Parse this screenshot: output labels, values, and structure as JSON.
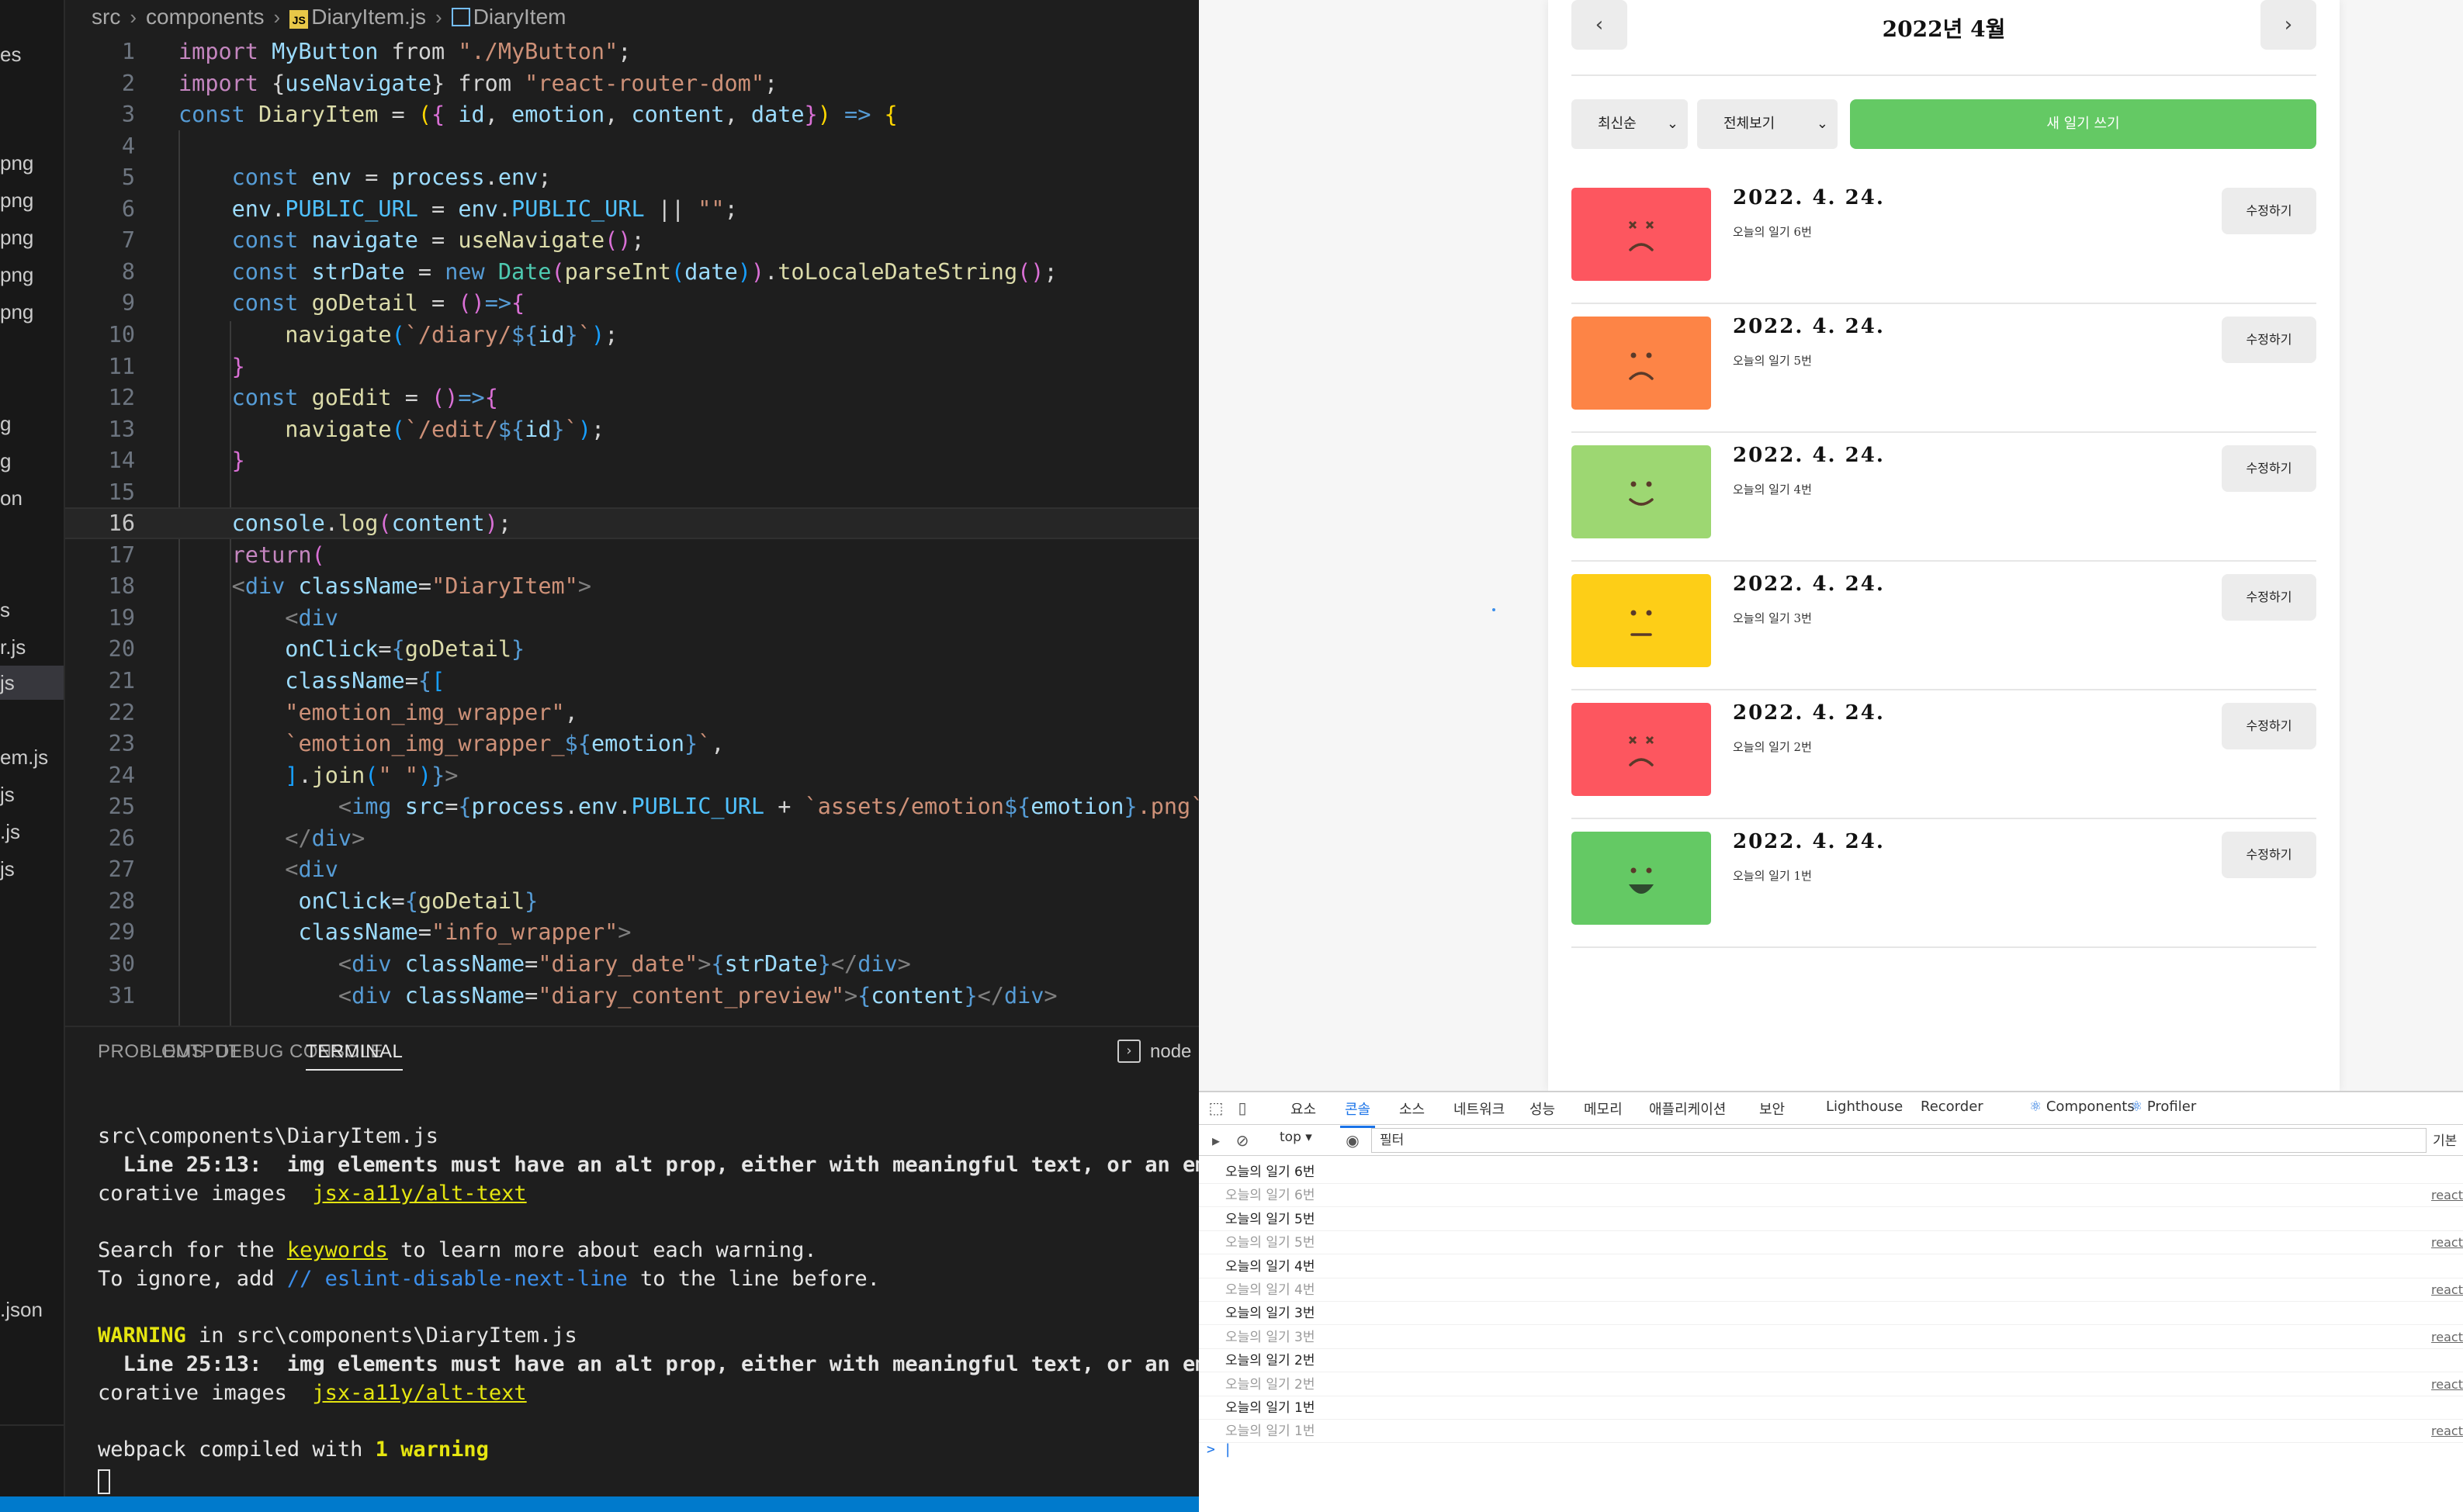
{
  "explorer": {
    "items": [
      "es",
      "png",
      "png",
      "png",
      "png",
      "png",
      "g",
      "g",
      "on",
      "s",
      "r.js",
      "js",
      "",
      "em.js",
      "js",
      ".js",
      "js",
      ".json"
    ]
  },
  "breadcrumb": {
    "folder1": "src",
    "folder2": "components",
    "file": "DiaryItem.js",
    "symbol": "DiaryItem"
  },
  "editor": {
    "current_line": "16",
    "lines": [
      {
        "n": "1",
        "segs": [
          [
            "kw2",
            "import "
          ],
          [
            "var",
            "MyButton"
          ],
          [
            "p",
            " from "
          ],
          [
            "str",
            "\"./MyButton\""
          ],
          [
            "p",
            ";"
          ]
        ]
      },
      {
        "n": "2",
        "segs": [
          [
            "kw2",
            "import "
          ],
          [
            "p",
            "{"
          ],
          [
            "var",
            "useNavigate"
          ],
          [
            "p",
            "} from "
          ],
          [
            "str",
            "\"react-router-dom\""
          ],
          [
            "p",
            ";"
          ]
        ]
      },
      {
        "n": "3",
        "segs": [
          [
            "kw",
            "const "
          ],
          [
            "fn",
            "DiaryItem"
          ],
          [
            "p",
            " = "
          ],
          [
            "b1",
            "("
          ],
          [
            "b2",
            "{"
          ],
          [
            "var",
            " id"
          ],
          [
            "p",
            ", "
          ],
          [
            "var",
            "emotion"
          ],
          [
            "p",
            ", "
          ],
          [
            "var",
            "content"
          ],
          [
            "p",
            ", "
          ],
          [
            "var",
            "date"
          ],
          [
            "b2",
            "}"
          ],
          [
            "b1",
            ")"
          ],
          [
            "kw",
            " =>"
          ],
          [
            "p",
            " "
          ],
          [
            "b1",
            "{"
          ]
        ]
      },
      {
        "n": "4",
        "segs": []
      },
      {
        "n": "5",
        "segs": [
          [
            "p",
            "    "
          ],
          [
            "kw",
            "const "
          ],
          [
            "var",
            "env"
          ],
          [
            "p",
            " = "
          ],
          [
            "var",
            "process"
          ],
          [
            "p",
            "."
          ],
          [
            "var",
            "env"
          ],
          [
            "p",
            ";"
          ]
        ]
      },
      {
        "n": "6",
        "segs": [
          [
            "p",
            "    "
          ],
          [
            "var",
            "env"
          ],
          [
            "p",
            "."
          ],
          [
            "const",
            "PUBLIC_URL"
          ],
          [
            "p",
            " = "
          ],
          [
            "var",
            "env"
          ],
          [
            "p",
            "."
          ],
          [
            "const",
            "PUBLIC_URL"
          ],
          [
            "p",
            " || "
          ],
          [
            "str",
            "\"\""
          ],
          [
            "p",
            ";"
          ]
        ]
      },
      {
        "n": "7",
        "segs": [
          [
            "p",
            "    "
          ],
          [
            "kw",
            "const "
          ],
          [
            "var",
            "navigate"
          ],
          [
            "p",
            " = "
          ],
          [
            "fn",
            "useNavigate"
          ],
          [
            "b2",
            "()"
          ],
          [
            "p",
            ";"
          ]
        ]
      },
      {
        "n": "8",
        "segs": [
          [
            "p",
            "    "
          ],
          [
            "kw",
            "const "
          ],
          [
            "var",
            "strDate"
          ],
          [
            "p",
            " = "
          ],
          [
            "kw",
            "new "
          ],
          [
            "cls",
            "Date"
          ],
          [
            "b2",
            "("
          ],
          [
            "fn",
            "parseInt"
          ],
          [
            "b3",
            "("
          ],
          [
            "var",
            "date"
          ],
          [
            "b3",
            ")"
          ],
          [
            "b2",
            ")"
          ],
          [
            "p",
            "."
          ],
          [
            "fn",
            "toLocaleDateString"
          ],
          [
            "b2",
            "()"
          ],
          [
            "p",
            ";"
          ]
        ]
      },
      {
        "n": "9",
        "segs": [
          [
            "p",
            "    "
          ],
          [
            "kw",
            "const "
          ],
          [
            "fn",
            "goDetail"
          ],
          [
            "p",
            " = "
          ],
          [
            "b2",
            "()"
          ],
          [
            "kw",
            "=>"
          ],
          [
            "b2",
            "{"
          ]
        ]
      },
      {
        "n": "10",
        "segs": [
          [
            "p",
            "        "
          ],
          [
            "fn",
            "navigate"
          ],
          [
            "b3",
            "("
          ],
          [
            "str",
            "`/diary/"
          ],
          [
            "kw",
            "${"
          ],
          [
            "var",
            "id"
          ],
          [
            "kw",
            "}"
          ],
          [
            "str",
            "`"
          ],
          [
            "b3",
            ")"
          ],
          [
            "p",
            ";"
          ]
        ]
      },
      {
        "n": "11",
        "segs": [
          [
            "p",
            "    "
          ],
          [
            "b2",
            "}"
          ]
        ]
      },
      {
        "n": "12",
        "segs": [
          [
            "p",
            "    "
          ],
          [
            "kw",
            "const "
          ],
          [
            "fn",
            "goEdit"
          ],
          [
            "p",
            " = "
          ],
          [
            "b2",
            "()"
          ],
          [
            "kw",
            "=>"
          ],
          [
            "b2",
            "{"
          ]
        ]
      },
      {
        "n": "13",
        "segs": [
          [
            "p",
            "        "
          ],
          [
            "fn",
            "navigate"
          ],
          [
            "b3",
            "("
          ],
          [
            "str",
            "`/edit/"
          ],
          [
            "kw",
            "${"
          ],
          [
            "var",
            "id"
          ],
          [
            "kw",
            "}"
          ],
          [
            "str",
            "`"
          ],
          [
            "b3",
            ")"
          ],
          [
            "p",
            ";"
          ]
        ]
      },
      {
        "n": "14",
        "segs": [
          [
            "p",
            "    "
          ],
          [
            "b2",
            "}"
          ]
        ]
      },
      {
        "n": "15",
        "segs": []
      },
      {
        "n": "16",
        "segs": [
          [
            "p",
            "    "
          ],
          [
            "var",
            "console"
          ],
          [
            "p",
            "."
          ],
          [
            "fn",
            "log"
          ],
          [
            "b2",
            "("
          ],
          [
            "var",
            "content"
          ],
          [
            "b2",
            ")"
          ],
          [
            "p",
            ";"
          ]
        ]
      },
      {
        "n": "17",
        "segs": [
          [
            "p",
            "    "
          ],
          [
            "kw2",
            "return"
          ],
          [
            "b2",
            "("
          ]
        ]
      },
      {
        "n": "18",
        "segs": [
          [
            "p",
            "    "
          ],
          [
            "tag",
            "<"
          ],
          [
            "kw",
            "div "
          ],
          [
            "attr",
            "className"
          ],
          [
            "p",
            "="
          ],
          [
            "str",
            "\"DiaryItem\""
          ],
          [
            "tag",
            ">"
          ]
        ]
      },
      {
        "n": "19",
        "segs": [
          [
            "p",
            "        "
          ],
          [
            "tag",
            "<"
          ],
          [
            "kw",
            "div"
          ]
        ]
      },
      {
        "n": "20",
        "segs": [
          [
            "p",
            "        "
          ],
          [
            "attr",
            "onClick"
          ],
          [
            "p",
            "="
          ],
          [
            "kw",
            "{"
          ],
          [
            "fn",
            "goDetail"
          ],
          [
            "kw",
            "}"
          ]
        ]
      },
      {
        "n": "21",
        "segs": [
          [
            "p",
            "        "
          ],
          [
            "attr",
            "className"
          ],
          [
            "p",
            "="
          ],
          [
            "kw",
            "{"
          ],
          [
            "b3",
            "["
          ]
        ]
      },
      {
        "n": "22",
        "segs": [
          [
            "p",
            "        "
          ],
          [
            "str",
            "\"emotion_img_wrapper\""
          ],
          [
            "p",
            ","
          ]
        ]
      },
      {
        "n": "23",
        "segs": [
          [
            "p",
            "        "
          ],
          [
            "str",
            "`emotion_img_wrapper_"
          ],
          [
            "kw",
            "${"
          ],
          [
            "var",
            "emotion"
          ],
          [
            "kw",
            "}"
          ],
          [
            "str",
            "`"
          ],
          [
            "p",
            ","
          ]
        ]
      },
      {
        "n": "24",
        "segs": [
          [
            "p",
            "        "
          ],
          [
            "b3",
            "]"
          ],
          [
            "p",
            "."
          ],
          [
            "fn",
            "join"
          ],
          [
            "b3",
            "("
          ],
          [
            "str",
            "\" \""
          ],
          [
            "b3",
            ")"
          ],
          [
            "kw",
            "}"
          ],
          [
            "tag",
            ">"
          ]
        ]
      },
      {
        "n": "25",
        "segs": [
          [
            "p",
            "            "
          ],
          [
            "tag",
            "<"
          ],
          [
            "kw",
            "img "
          ],
          [
            "attr",
            "src"
          ],
          [
            "p",
            "="
          ],
          [
            "kw",
            "{"
          ],
          [
            "var",
            "process"
          ],
          [
            "p",
            "."
          ],
          [
            "var",
            "env"
          ],
          [
            "p",
            "."
          ],
          [
            "const",
            "PUBLIC_URL"
          ],
          [
            "p",
            " + "
          ],
          [
            "str",
            "`assets/emotion"
          ],
          [
            "kw",
            "${"
          ],
          [
            "var",
            "emotion"
          ],
          [
            "kw",
            "}"
          ],
          [
            "str",
            ".png`"
          ],
          [
            "kw",
            "}"
          ],
          [
            "tag",
            ">"
          ]
        ]
      },
      {
        "n": "26",
        "segs": [
          [
            "p",
            "        "
          ],
          [
            "tag",
            "</"
          ],
          [
            "kw",
            "div"
          ],
          [
            "tag",
            ">"
          ]
        ]
      },
      {
        "n": "27",
        "segs": [
          [
            "p",
            "        "
          ],
          [
            "tag",
            "<"
          ],
          [
            "kw",
            "div"
          ]
        ]
      },
      {
        "n": "28",
        "segs": [
          [
            "p",
            "         "
          ],
          [
            "attr",
            "onClick"
          ],
          [
            "p",
            "="
          ],
          [
            "kw",
            "{"
          ],
          [
            "fn",
            "goDetail"
          ],
          [
            "kw",
            "}"
          ]
        ]
      },
      {
        "n": "29",
        "segs": [
          [
            "p",
            "         "
          ],
          [
            "attr",
            "className"
          ],
          [
            "p",
            "="
          ],
          [
            "str",
            "\"info_wrapper\""
          ],
          [
            "tag",
            ">"
          ]
        ]
      },
      {
        "n": "30",
        "segs": [
          [
            "p",
            "            "
          ],
          [
            "tag",
            "<"
          ],
          [
            "kw",
            "div "
          ],
          [
            "attr",
            "className"
          ],
          [
            "p",
            "="
          ],
          [
            "str",
            "\"diary_date\""
          ],
          [
            "tag",
            ">"
          ],
          [
            "kw",
            "{"
          ],
          [
            "var",
            "strDate"
          ],
          [
            "kw",
            "}"
          ],
          [
            "tag",
            "</"
          ],
          [
            "kw",
            "div"
          ],
          [
            "tag",
            ">"
          ]
        ]
      },
      {
        "n": "31",
        "segs": [
          [
            "p",
            "            "
          ],
          [
            "tag",
            "<"
          ],
          [
            "kw",
            "div "
          ],
          [
            "attr",
            "className"
          ],
          [
            "p",
            "="
          ],
          [
            "str",
            "\"diary_content_preview\""
          ],
          [
            "tag",
            ">"
          ],
          [
            "kw",
            "{"
          ],
          [
            "var",
            "content"
          ],
          [
            "kw",
            "}"
          ],
          [
            "tag",
            "</"
          ],
          [
            "kw",
            "div"
          ],
          [
            "tag",
            ">"
          ]
        ]
      }
    ]
  },
  "panel": {
    "tabs": [
      "PROBLEMS",
      "OUTPUT",
      "DEBUG CONSOLE",
      "TERMINAL"
    ],
    "active_tab": "TERMINAL",
    "terminal_name": "node"
  },
  "terminal": {
    "file_line_1": "src\\components\\DiaryItem.js",
    "warn_line_1": "  Line 25:13:  img elements must have an alt prop, either with meaningful text, or an emp",
    "decor_label": "corative images  ",
    "rule_link": "jsx-a11y/alt-text",
    "search_pre": "Search for the ",
    "search_kw": "keywords",
    "search_post": " to learn more about each warning.",
    "ignore_pre": "To ignore, add ",
    "ignore_comment": "// eslint-disable-next-line",
    "ignore_post": " to the line before.",
    "warning_word": "WARNING",
    "warning_post": " in src\\components\\DiaryItem.js",
    "warn_line_2": "  Line 25:13:  img elements must have an alt prop, either with meaningful text, or an emp",
    "compiled_pre": "webpack compiled with ",
    "compiled_count": "1 warning"
  },
  "app": {
    "header_title": "2022년 4월",
    "prev_icon": "‹",
    "next_icon": "›",
    "sort_select": "최신순",
    "filter_select": "전체보기",
    "new_button": "새 일기 쓰기",
    "items": [
      {
        "emotion": 5,
        "color": "#fd565f",
        "date": "2022. 4. 24.",
        "content": "오늘의 일기 6번",
        "edit": "수정하기"
      },
      {
        "emotion": 4,
        "color": "#fd8446",
        "date": "2022. 4. 24.",
        "content": "오늘의 일기 5번",
        "edit": "수정하기"
      },
      {
        "emotion": 2,
        "color": "#9dd772",
        "date": "2022. 4. 24.",
        "content": "오늘의 일기 4번",
        "edit": "수정하기"
      },
      {
        "emotion": 3,
        "color": "#fdce17",
        "date": "2022. 4. 24.",
        "content": "오늘의 일기 3번",
        "edit": "수정하기"
      },
      {
        "emotion": 5,
        "color": "#fd565f",
        "date": "2022. 4. 24.",
        "content": "오늘의 일기 2번",
        "edit": "수정하기"
      },
      {
        "emotion": 1,
        "color": "#64c964",
        "date": "2022. 4. 24.",
        "content": "오늘의 일기 1번",
        "edit": "수정하기"
      }
    ]
  },
  "devtools": {
    "tabs": [
      "요소",
      "콘솔",
      "소스",
      "네트워크",
      "성능",
      "메모리",
      "애플리케이션",
      "보안",
      "Lighthouse",
      "Recorder",
      "Components",
      "Profiler"
    ],
    "active_tab": "콘솔",
    "context": "top ▾",
    "filter_placeholder": "필터",
    "levels_label": "기본",
    "logs": [
      {
        "text": "오늘의 일기 6번",
        "dim": false,
        "src": ""
      },
      {
        "text": "오늘의 일기 6번",
        "dim": true,
        "src": "react"
      },
      {
        "text": "오늘의 일기 5번",
        "dim": false,
        "src": ""
      },
      {
        "text": "오늘의 일기 5번",
        "dim": true,
        "src": "react"
      },
      {
        "text": "오늘의 일기 4번",
        "dim": false,
        "src": ""
      },
      {
        "text": "오늘의 일기 4번",
        "dim": true,
        "src": "react"
      },
      {
        "text": "오늘의 일기 3번",
        "dim": false,
        "src": ""
      },
      {
        "text": "오늘의 일기 3번",
        "dim": true,
        "src": "react"
      },
      {
        "text": "오늘의 일기 2번",
        "dim": false,
        "src": ""
      },
      {
        "text": "오늘의 일기 2번",
        "dim": true,
        "src": "react"
      },
      {
        "text": "오늘의 일기 1번",
        "dim": false,
        "src": ""
      },
      {
        "text": "오늘의 일기 1번",
        "dim": true,
        "src": "react"
      }
    ],
    "prompt": "> "
  }
}
